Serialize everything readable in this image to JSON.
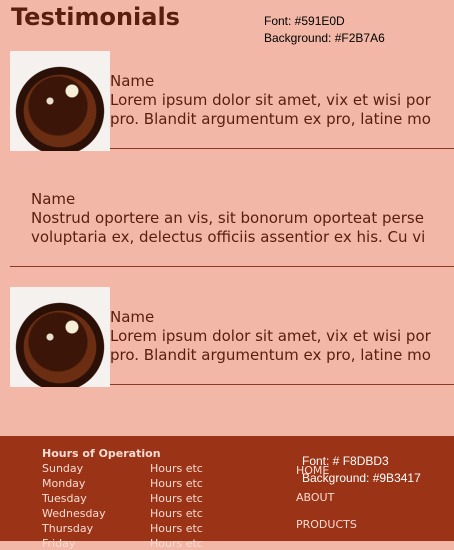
{
  "page": {
    "title": "Testimonials",
    "font_color": "#591E0D",
    "background_color": "#F2B7A6"
  },
  "annotations": {
    "top_font": "Font: #591E0D",
    "top_background": "Background: #F2B7A6",
    "footer_font": "Font: # F8DBD3",
    "footer_background": "Background: #9B3417"
  },
  "testimonials": [
    {
      "name": "Name",
      "line1": "Lorem ipsum dolor sit amet, vix et wisi por",
      "line2": "pro. Blandit argumentum ex pro, latine mo",
      "image_icon": "cake-photo"
    },
    {
      "name": "Name",
      "line1": "Nostrud oportere an vis, sit bonorum oporteat perse",
      "line2": "voluptaria ex, delectus officiis assentior ex his. Cu vi"
    },
    {
      "name": "Name",
      "line1": "Lorem ipsum dolor sit amet, vix et wisi por",
      "line2": "pro. Blandit argumentum ex pro, latine mo",
      "image_icon": "cake-photo"
    }
  ],
  "footer": {
    "background_color": "#9B3417",
    "font_color": "#F8DBD3",
    "hours_title": "Hours of Operation",
    "hours": [
      {
        "day": "Sunday",
        "hours": "Hours etc"
      },
      {
        "day": "Monday",
        "hours": "Hours etc"
      },
      {
        "day": "Tuesday",
        "hours": "Hours etc"
      },
      {
        "day": "Wednesday",
        "hours": "Hours etc"
      },
      {
        "day": "Thursday",
        "hours": "Hours etc"
      },
      {
        "day": "Friday",
        "hours": "Hours etc"
      }
    ],
    "nav": [
      "HOME",
      "ABOUT",
      "PRODUCTS"
    ]
  }
}
